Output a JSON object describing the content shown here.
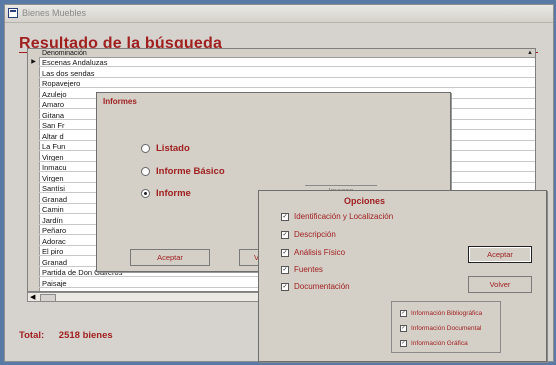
{
  "window": {
    "title": "Bienes Muebles"
  },
  "results": {
    "heading": "Resultado de la búsqueda",
    "column_header": "Denominación",
    "rows": [
      "Escenas Andaluzas",
      "Las dos sendas",
      "Ropavejero",
      "Azulejo",
      "Amaro",
      "Gitana",
      "San Fr",
      "Altar d",
      "La Fun",
      "Virgen",
      "Inmacu",
      "Virgen",
      "Santísi",
      "Granad",
      "Camin",
      "Jardín",
      "Peñaro",
      "Adorac",
      "El piro",
      "Granad",
      "Partida de Don Gaiferos",
      "Paisaje"
    ],
    "total_label": "Total:",
    "total_value": "2518 bienes"
  },
  "informes_dialog": {
    "title": "Informes",
    "options": [
      "Listado",
      "Informe Básico",
      "Informe"
    ],
    "selected": "Informe",
    "accept_label": "Aceptar",
    "back_label": "Vo",
    "image_label": "Imagen"
  },
  "opciones_dialog": {
    "title": "Opciones",
    "checks": [
      "Identificación y Localización",
      "Descripción",
      "Análisis Físico",
      "Fuentes",
      "Documentación"
    ],
    "sub_checks": [
      "Información Bibliográfica",
      "Información Documental",
      "Información Gráfica"
    ],
    "accept_label": "Aceptar",
    "back_label": "Volver"
  }
}
